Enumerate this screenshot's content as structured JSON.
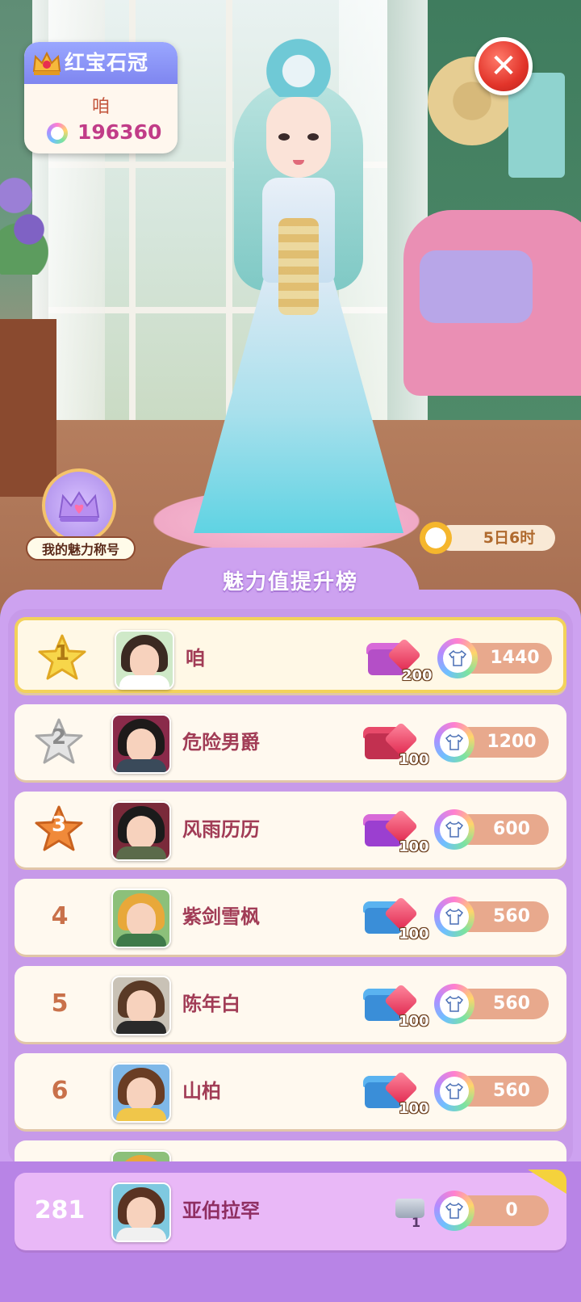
{
  "header": {
    "title_card": {
      "title": "红宝石冠",
      "player_name": "咱",
      "score": "196360"
    },
    "close_label": "✕",
    "charm_title_label": "我的魅力称号",
    "timer": "5日6时"
  },
  "leaderboard": {
    "title": "魅力值提升榜",
    "rows": [
      {
        "rank": "1",
        "name": "咱",
        "reward_qty": "200",
        "score": "1440"
      },
      {
        "rank": "2",
        "name": "危险男爵",
        "reward_qty": "100",
        "score": "1200"
      },
      {
        "rank": "3",
        "name": "风雨历历",
        "reward_qty": "100",
        "score": "600"
      },
      {
        "rank": "4",
        "name": "紫剑雪枫",
        "reward_qty": "100",
        "score": "560"
      },
      {
        "rank": "5",
        "name": "陈年白",
        "reward_qty": "100",
        "score": "560"
      },
      {
        "rank": "6",
        "name": "山柏",
        "reward_qty": "100",
        "score": "560"
      }
    ],
    "self": {
      "rank": "281",
      "name": "亚伯拉罕",
      "reward_qty": "1",
      "score": "0"
    }
  },
  "colors": {
    "panel": "#cda2f0",
    "gold_star": "#f7d64a",
    "silver_star": "#d8d8d8",
    "bronze_star": "#f08a3a",
    "close": "#e2342a"
  },
  "icons": [
    "crown-icon",
    "close-icon",
    "clock-icon",
    "star-icon",
    "treasure-chest-icon",
    "gem-icon",
    "shirt-icon"
  ]
}
